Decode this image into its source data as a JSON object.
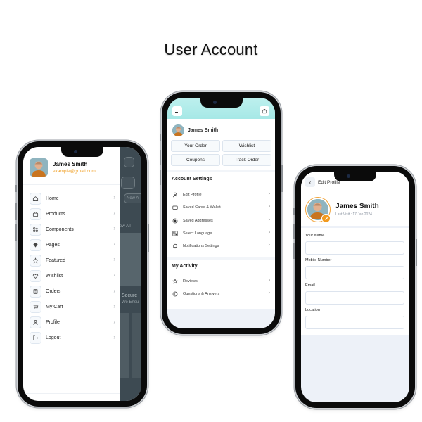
{
  "page": {
    "title": "User Account"
  },
  "drawer_screen": {
    "user": {
      "name": "James Smith",
      "email": "example@gmail.com"
    },
    "menu": [
      {
        "label": "Home",
        "icon": "home-icon"
      },
      {
        "label": "Products",
        "icon": "shopping-bag-icon"
      },
      {
        "label": "Components",
        "icon": "components-icon"
      },
      {
        "label": "Pages",
        "icon": "pages-icon"
      },
      {
        "label": "Featured",
        "icon": "star-icon"
      },
      {
        "label": "Wishlist",
        "icon": "heart-icon"
      },
      {
        "label": "Orders",
        "icon": "orders-icon"
      },
      {
        "label": "My Cart",
        "icon": "cart-icon"
      },
      {
        "label": "Profile",
        "icon": "user-icon"
      },
      {
        "label": "Logout",
        "icon": "logout-icon"
      }
    ],
    "background_fragments": {
      "new_arrivals": "New A",
      "view_all": "ew All",
      "secure": "Secure",
      "secure_sub": "We Ensu"
    }
  },
  "account_screen": {
    "user": {
      "name": "James Smith"
    },
    "quick_actions": [
      "Your Order",
      "Wishlist",
      "Coupons",
      "Track Order"
    ],
    "account_settings": {
      "title": "Account Settings",
      "items": [
        {
          "label": "Edit Profile",
          "icon": "user-icon"
        },
        {
          "label": "Saved Cards & Wallet",
          "icon": "card-icon"
        },
        {
          "label": "Saved Addresses",
          "icon": "location-target-icon"
        },
        {
          "label": "Select Language",
          "icon": "language-icon"
        },
        {
          "label": "Notifications Settings",
          "icon": "bell-icon"
        }
      ]
    },
    "my_activity": {
      "title": "My Activity",
      "items": [
        {
          "label": "Reviews",
          "icon": "star-icon"
        },
        {
          "label": "Questions & Answers",
          "icon": "qa-icon"
        }
      ]
    }
  },
  "edit_profile_screen": {
    "header": {
      "title": "Edit Profile"
    },
    "user": {
      "name": "James Smith",
      "last_visit": "Last Visit : 17 Jan 2024"
    },
    "fields": [
      {
        "label": "Your Name",
        "value": "",
        "placeholder": ""
      },
      {
        "label": "Mobile Number",
        "value": "",
        "placeholder": ""
      },
      {
        "label": "Email",
        "value": "",
        "placeholder": ""
      },
      {
        "label": "Location",
        "value": "",
        "placeholder": ""
      }
    ]
  },
  "colors": {
    "accent_orange": "#f29a1f",
    "header_teal": "#a6e8e6",
    "email_orange": "#f0a22b"
  }
}
